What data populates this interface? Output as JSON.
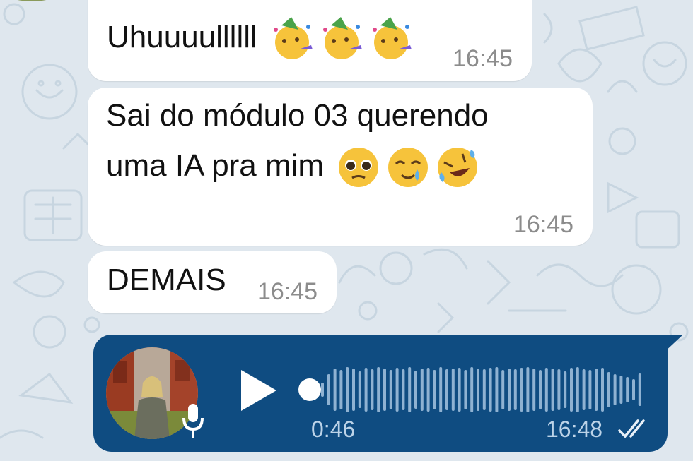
{
  "messages": [
    {
      "text": "Uhuuuullllll",
      "time": "16:45",
      "emojis": [
        "partying-face-icon",
        "partying-face-icon",
        "partying-face-icon"
      ]
    },
    {
      "line1": "Sai do módulo 03 querendo",
      "line2": "uma IA pra mim",
      "time": "16:45",
      "emojis": [
        "pleading-face-icon",
        "smiling-face-with-tear-icon",
        "rolling-on-floor-laughing-icon"
      ]
    },
    {
      "text": "DEMAIS",
      "time": "16:45"
    }
  ],
  "voice_message": {
    "duration": "0:46",
    "time": "16:48",
    "status_icon": "double-check-icon",
    "progress": 0
  },
  "colors": {
    "background": "#dfe7ee",
    "incoming_bubble": "#ffffff",
    "outgoing_bubble": "#0f4c81",
    "timestamp": "#8c8c8c",
    "voice_meta": "#bcd3e8"
  }
}
